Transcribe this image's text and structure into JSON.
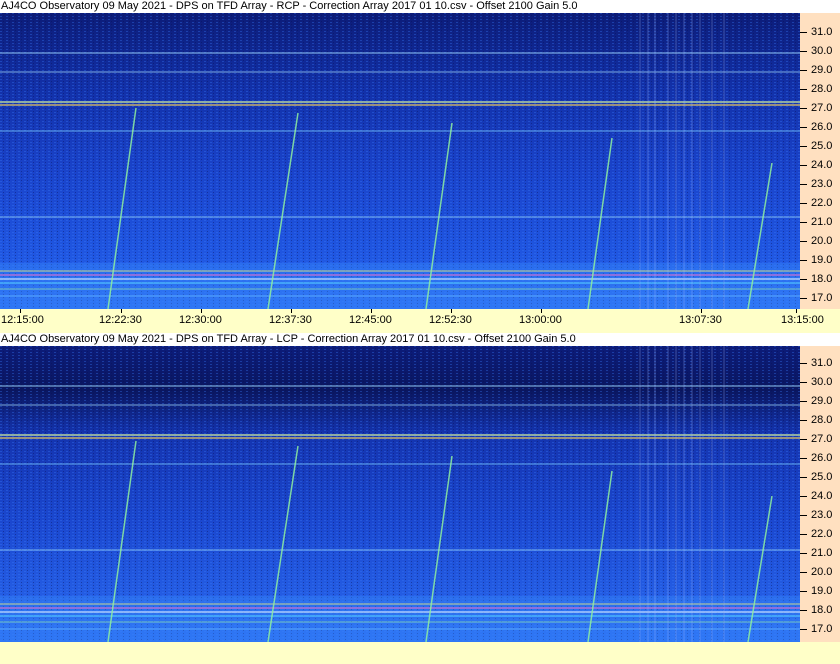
{
  "panels": [
    {
      "title": "AJ4CO Observatory 09 May 2021  -  DPS on TFD Array  -  RCP  -  Correction Array 2017 01 10.csv  -  Offset 2100  Gain 5.0",
      "freq_labels": [
        "31.0",
        "30.0",
        "29.0",
        "28.0",
        "27.0",
        "26.0",
        "25.0",
        "24.0",
        "23.0",
        "22.0",
        "21.0",
        "20.0",
        "19.0",
        "18.0",
        "17.0"
      ],
      "time_labels": [
        "12:15:00",
        "12:22:30",
        "12:30:00",
        "12:37:30",
        "12:45:00",
        "12:52:30",
        "13:00:00",
        "13:07:30",
        "13:15:00"
      ]
    },
    {
      "title": "AJ4CO Observatory 09 May 2021  -  DPS on TFD Array  -  LCP  -  Correction Array 2017 01 10.csv  -  Offset 2100  Gain 5.0",
      "freq_labels": [
        "31.0",
        "30.0",
        "29.0",
        "28.0",
        "27.0",
        "26.0",
        "25.0",
        "24.0",
        "23.0",
        "22.0",
        "21.0",
        "20.0",
        "19.0",
        "18.0",
        "17.0"
      ]
    }
  ],
  "colors": {
    "background_dark": "#0a1a6e",
    "background_mid": "#1a40c8",
    "axis_bg": "#ffe0c0",
    "time_axis_bg": "#ffffc8",
    "burst": "#7fe08a"
  }
}
